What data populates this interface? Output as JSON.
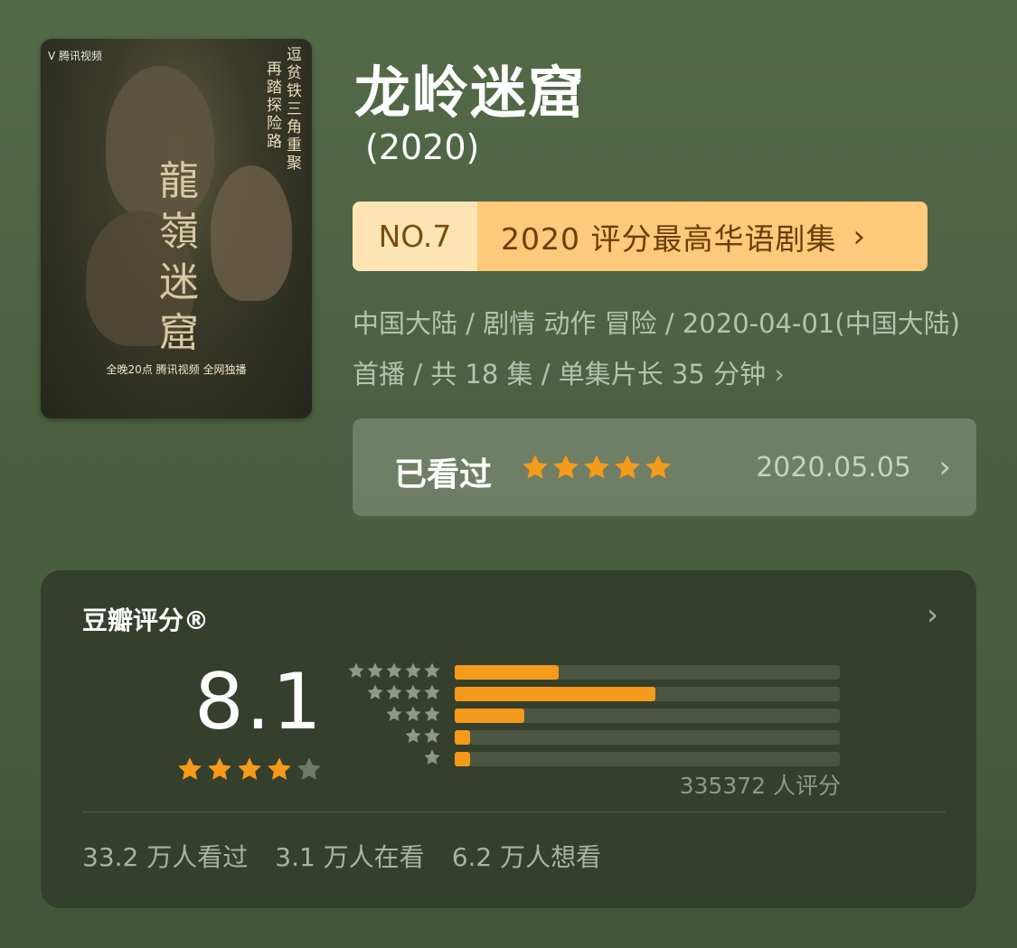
{
  "poster": {
    "logo_text": "V 腾讯视频",
    "calligraphy": "龍嶺迷窟",
    "vtext_1": "逗贫铁三角重聚",
    "vtext_2": "再踏探险路",
    "bottom_line": "全晚20点 腾讯视频 全网独播"
  },
  "title": "龙岭迷窟",
  "year": "(2020)",
  "ranking": {
    "no": "NO.7",
    "text": "2020 评分最高华语剧集",
    "chevron": "›"
  },
  "meta": {
    "line": "中国大陆 / 剧情 动作 冒险 / 2020-04-01(中国大陆) 首播 / 共 18 集 / 单集片长 35 分钟",
    "chevron": "›"
  },
  "watched": {
    "label": "已看过",
    "stars": 5,
    "date": "2020.05.05",
    "chevron": "›"
  },
  "rating": {
    "header": "豆瓣评分®",
    "chevron": "›",
    "score": "8.1",
    "stars": 4,
    "count": "335372 人评分",
    "distribution": [
      {
        "stars": 5,
        "fraction": 0.27
      },
      {
        "stars": 4,
        "fraction": 0.52
      },
      {
        "stars": 3,
        "fraction": 0.18
      },
      {
        "stars": 2,
        "fraction": 0.04
      },
      {
        "stars": 1,
        "fraction": 0.04
      }
    ]
  },
  "stats": [
    "33.2 万人看过",
    "3.1 万人在看",
    "6.2 万人想看"
  ],
  "colors": {
    "star_orange": "#f59a1a",
    "star_empty": "#6f7a67",
    "mini_star": "#8e9986",
    "rank_light": "#fde6b4",
    "rank_orange": "#fdc97a"
  },
  "icons": {
    "chevron": "chevron-right-icon",
    "star": "star-icon"
  }
}
